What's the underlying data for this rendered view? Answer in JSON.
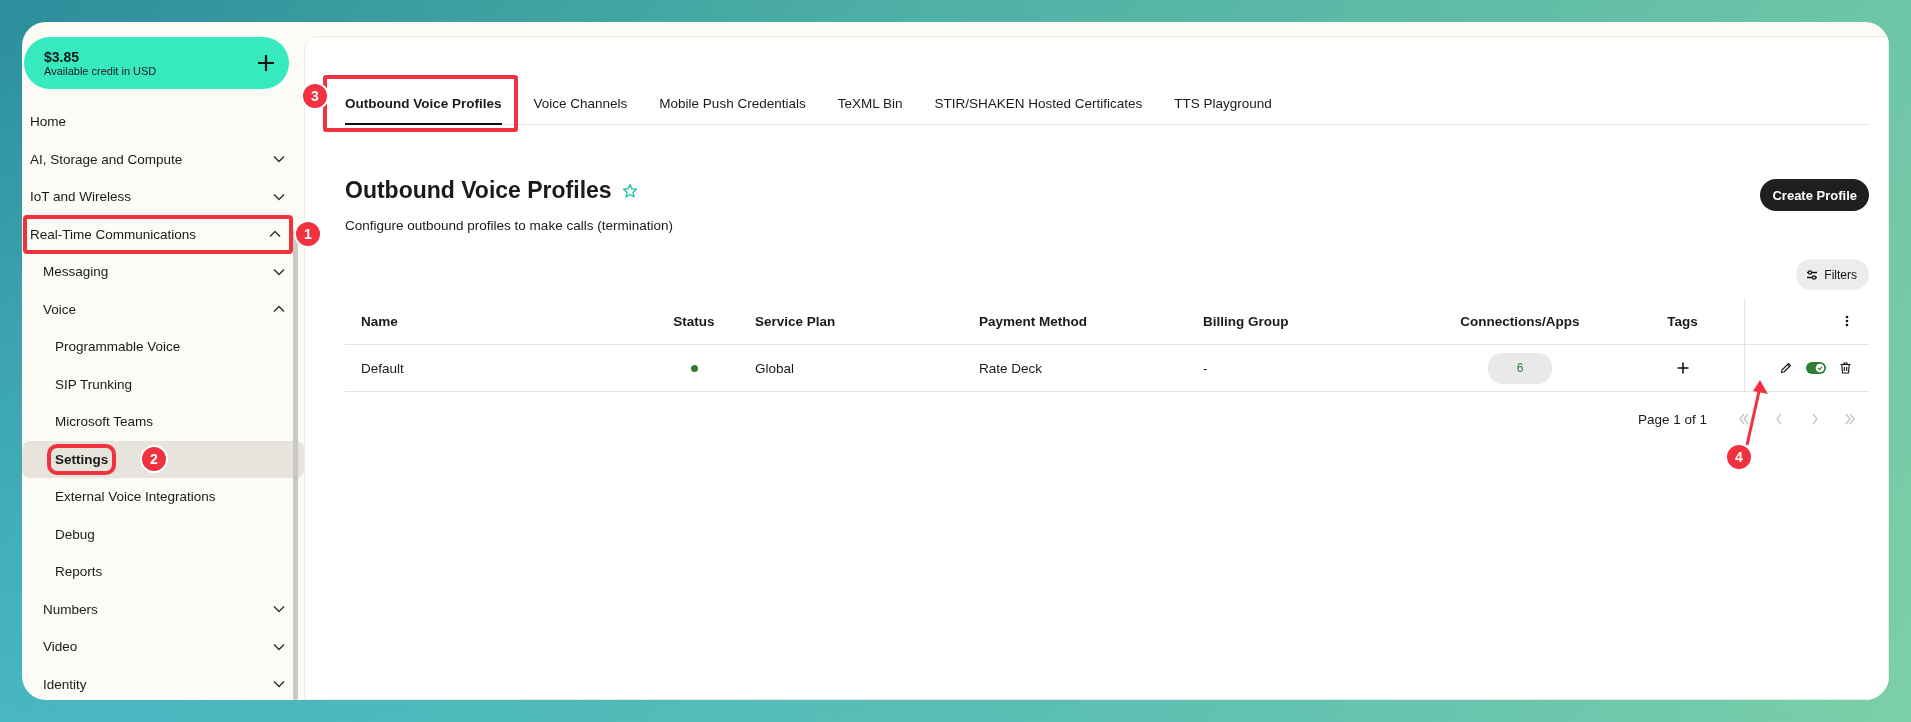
{
  "credit": {
    "amount": "$3.85",
    "label": "Available credit in USD"
  },
  "sidebar": {
    "items": [
      {
        "label": "Home",
        "selected": false
      },
      {
        "label": "AI, Storage and Compute",
        "expanded": false
      },
      {
        "label": "IoT and Wireless",
        "expanded": false
      },
      {
        "label": "Real-Time Communications",
        "expanded": true,
        "callout": "1",
        "children": [
          {
            "label": "Messaging",
            "expanded": false
          },
          {
            "label": "Voice",
            "expanded": true,
            "children": [
              {
                "label": "Programmable Voice",
                "selected": false
              },
              {
                "label": "SIP Trunking",
                "selected": false
              },
              {
                "label": "Microsoft Teams",
                "selected": false
              },
              {
                "label": "Settings",
                "selected": true,
                "callout": "2"
              },
              {
                "label": "External Voice Integrations",
                "selected": false
              },
              {
                "label": "Debug",
                "selected": false
              },
              {
                "label": "Reports",
                "selected": false
              }
            ]
          },
          {
            "label": "Numbers",
            "expanded": false
          },
          {
            "label": "Video",
            "expanded": false
          },
          {
            "label": "Identity",
            "expanded": false
          }
        ]
      }
    ]
  },
  "tabs": [
    {
      "label": "Outbound Voice Profiles",
      "selected": true,
      "callout": "3"
    },
    {
      "label": "Voice Channels",
      "selected": false
    },
    {
      "label": "Mobile Push Credentials",
      "selected": false
    },
    {
      "label": "TeXML Bin",
      "selected": false
    },
    {
      "label": "STIR/SHAKEN Hosted Certificates",
      "selected": false
    },
    {
      "label": "TTS Playground",
      "selected": false
    }
  ],
  "page": {
    "title": "Outbound Voice Profiles",
    "subtitle": "Configure outbound profiles to make calls (termination)",
    "create_button": "Create Profile",
    "filters_button": "Filters"
  },
  "table": {
    "columns": [
      "Name",
      "Status",
      "Service Plan",
      "Payment Method",
      "Billing Group",
      "Connections/Apps",
      "Tags"
    ],
    "rows": [
      {
        "name": "Default",
        "active": true,
        "service_plan": "Global",
        "payment_method": "Rate Deck",
        "billing_group": "-",
        "connections": "6",
        "enabled": true,
        "callout": "4"
      }
    ]
  },
  "pagination": {
    "label": "Page 1 of 1",
    "buttons": [
      {
        "kind": "first",
        "disabled": true
      },
      {
        "kind": "prev",
        "disabled": true
      },
      {
        "kind": "next",
        "disabled": true
      },
      {
        "kind": "last",
        "disabled": true
      }
    ]
  }
}
